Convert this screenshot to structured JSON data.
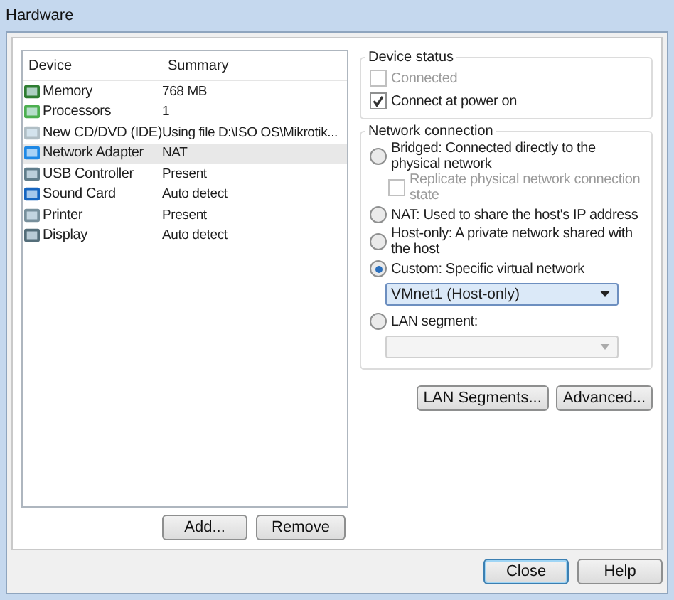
{
  "window": {
    "title": "Hardware"
  },
  "device_list": {
    "columns": [
      "Device",
      "Summary"
    ],
    "rows": [
      {
        "device": "Memory",
        "summary": "768 MB",
        "selected": false
      },
      {
        "device": "Processors",
        "summary": "1",
        "selected": false
      },
      {
        "device": "New CD/DVD (IDE)",
        "summary": "Using file D:\\ISO OS\\Mikrotik...",
        "selected": false
      },
      {
        "device": "Network Adapter",
        "summary": "NAT",
        "selected": true
      },
      {
        "device": "USB Controller",
        "summary": "Present",
        "selected": false
      },
      {
        "device": "Sound Card",
        "summary": "Auto detect",
        "selected": false
      },
      {
        "device": "Printer",
        "summary": "Present",
        "selected": false
      },
      {
        "device": "Display",
        "summary": "Auto detect",
        "selected": false
      }
    ],
    "buttons": [
      "Add...",
      "Remove"
    ]
  },
  "device_status": {
    "title": "Device status",
    "options": [
      {
        "label": "Connected",
        "checked": false,
        "disabled": true
      },
      {
        "label": "Connect at power on",
        "checked": true,
        "disabled": false
      }
    ]
  },
  "network_connection": {
    "title": "Network connection",
    "options": [
      {
        "kind": "radio",
        "label": "Bridged: Connected directly to the physical network",
        "selected": false
      },
      {
        "kind": "checkbox",
        "label": "Replicate physical network connection state",
        "checked": false,
        "disabled": true
      },
      {
        "kind": "radio",
        "label": "NAT: Used to share the host's IP address",
        "selected": false
      },
      {
        "kind": "radio",
        "label": "Host-only: A private network shared with the host",
        "selected": false
      },
      {
        "kind": "radio",
        "label": "Custom: Specific virtual network",
        "selected": true
      },
      {
        "kind": "dropdown",
        "value": "VMnet1 (Host-only)",
        "disabled": false
      },
      {
        "kind": "radio",
        "label": "LAN segment:",
        "selected": false
      },
      {
        "kind": "dropdown",
        "disabled": true
      }
    ]
  },
  "network_buttons": [
    "LAN Segments...",
    "Advanced..."
  ],
  "dialog_buttons": [
    {
      "label": "Close",
      "default": true
    },
    {
      "label": "Help",
      "default": false
    }
  ]
}
